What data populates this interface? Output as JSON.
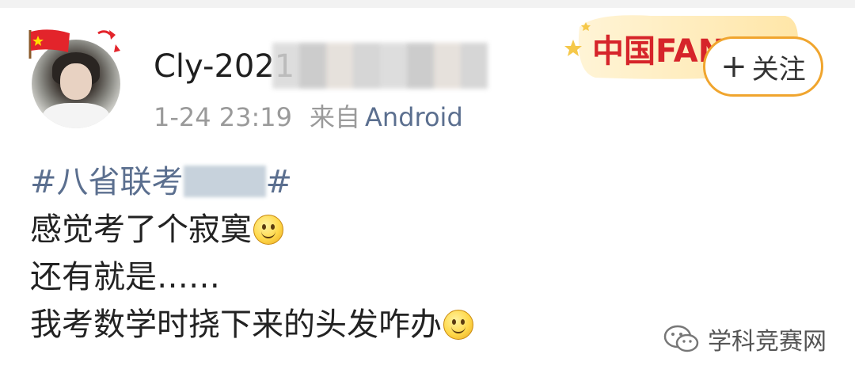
{
  "post": {
    "username": "Cly-2021",
    "time": "1-24 23:19",
    "source_prefix": "来自",
    "source_device": "Android",
    "badge": {
      "text": "中国FANS",
      "icon": "china-fans-badge"
    },
    "follow_button": {
      "plus": "+",
      "label": "关注"
    },
    "hashtag": {
      "open": "#八省联考",
      "close": "#"
    },
    "lines": [
      "感觉考了个寂寞",
      "还有就是……",
      "我考数学时挠下来的头发咋办"
    ],
    "emoji": "smile-emoji"
  },
  "watermark": {
    "text": "学科竞赛网",
    "icon": "wechat-icon"
  },
  "colors": {
    "link": "#5b6f8f",
    "meta": "#9a9a9a",
    "follow_border": "#f0a52e",
    "badge_red": "#d6242a"
  }
}
